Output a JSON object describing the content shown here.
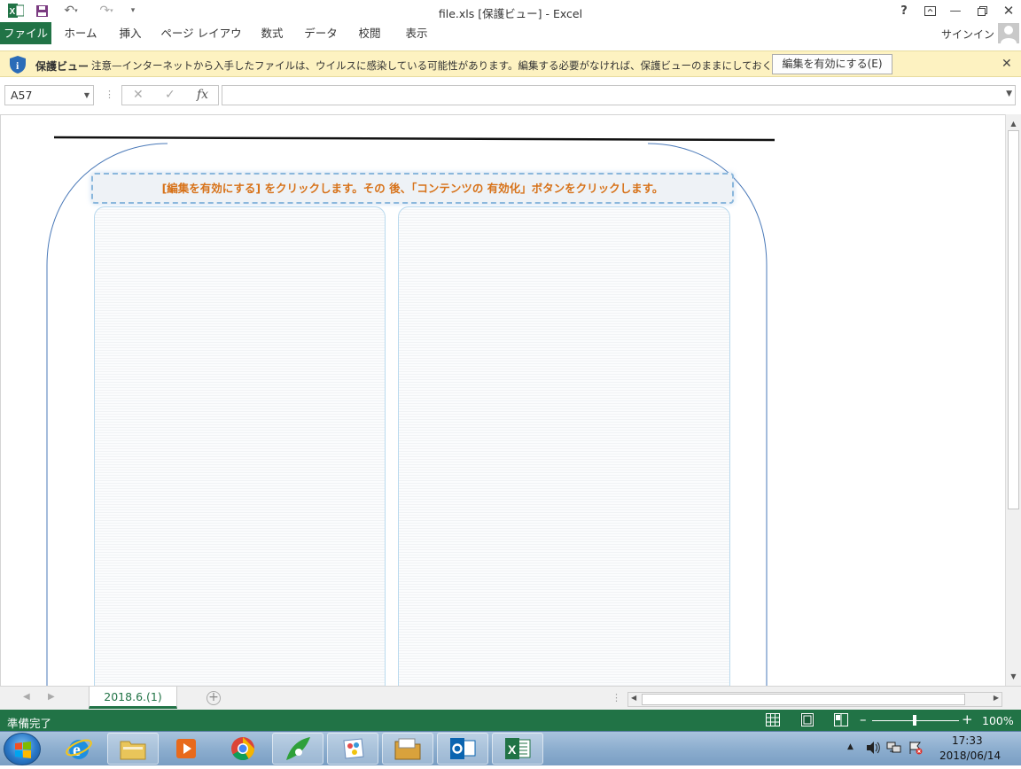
{
  "window": {
    "title": "file.xls [保護ビュー] - Excel",
    "help_label": "?",
    "app_icon": "excel-icon"
  },
  "ribbon": {
    "tabs": [
      "ファイル",
      "ホーム",
      "挿入",
      "ページ レイアウト",
      "数式",
      "データ",
      "校閲",
      "表示"
    ],
    "signin_label": "サインイン"
  },
  "protected_view": {
    "label": "保護ビュー",
    "message": "注意—インターネットから入手したファイルは、ウイルスに感染している可能性があります。編集する必要がなければ、保護ビューのままにしておくことをお勧めします。",
    "enable_button": "編集を有効にする(E)",
    "close": "✕"
  },
  "formula_bar": {
    "name_box": "A57",
    "fx_label": "fx",
    "cancel_symbol": "✕",
    "enter_symbol": "✓",
    "value": ""
  },
  "sheet": {
    "banner_text": "[編集を有効にする] をクリックします。その 後、「コンテンツの 有効化」ボタンをクリックします。"
  },
  "sheet_tabs": {
    "active": "2018.6.(1)",
    "add_symbol": "+"
  },
  "status_bar": {
    "status": "準備完了",
    "zoom": "100%",
    "zoom_minus": "–",
    "zoom_plus": "+"
  },
  "taskbar": {
    "time": "17:33",
    "date": "2018/06/14",
    "apps": [
      "internet-explorer-icon",
      "file-explorer-icon",
      "media-player-icon",
      "chrome-icon",
      "app-icon",
      "paint-icon",
      "folder-icon",
      "outlook-icon",
      "excel-icon"
    ]
  },
  "colors": {
    "excel_green": "#217346",
    "protected_bar": "#fdf2c1",
    "banner_text": "#d77219"
  }
}
